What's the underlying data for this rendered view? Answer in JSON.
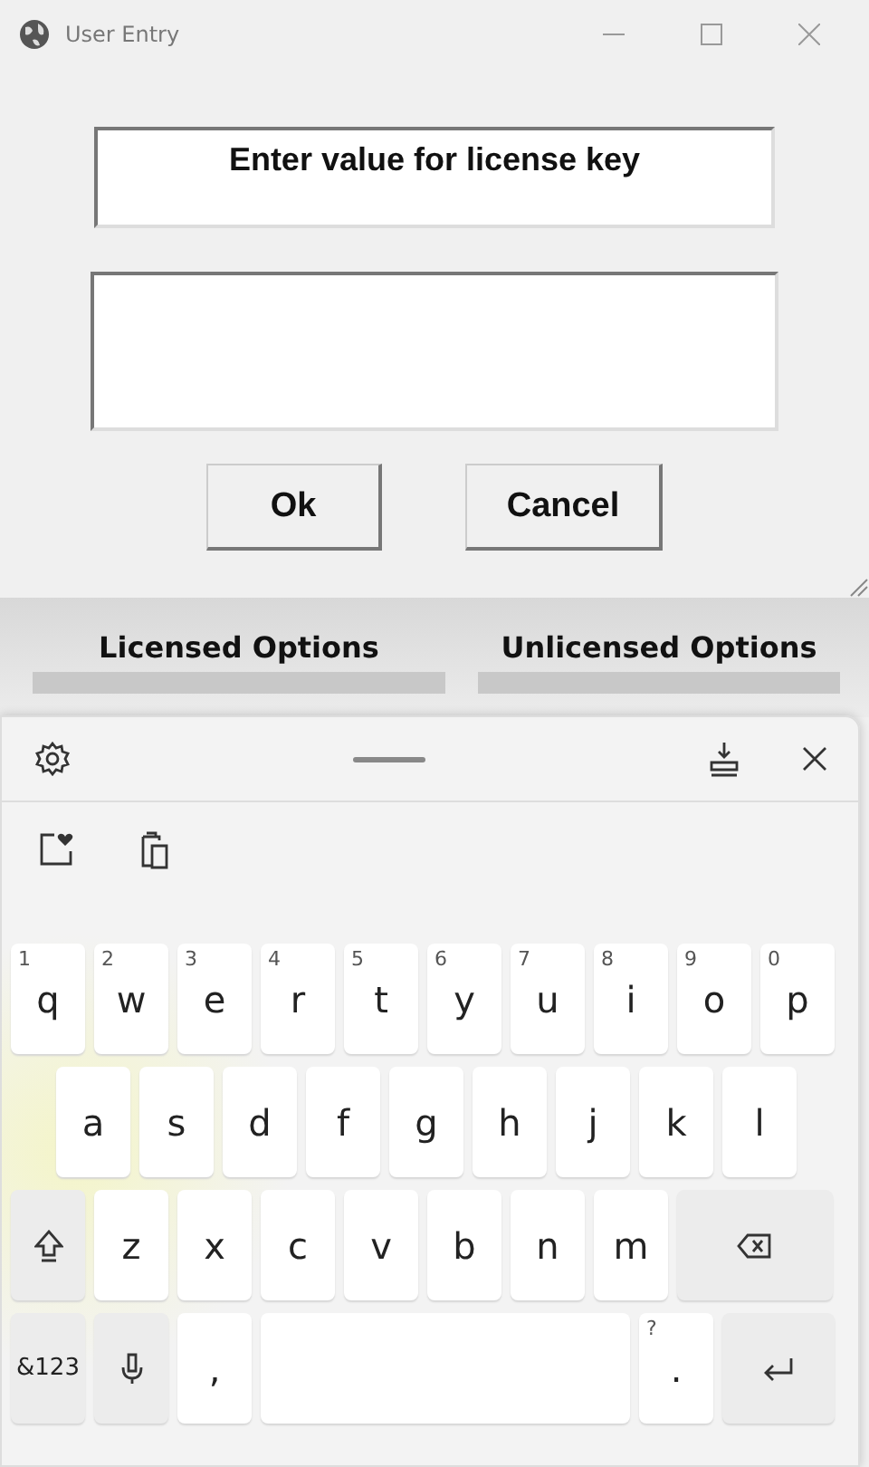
{
  "window": {
    "title": "User Entry"
  },
  "dialog": {
    "prompt": "Enter value for license key",
    "buttons": [
      {
        "label": "Ok"
      },
      {
        "label": "Cancel"
      }
    ]
  },
  "background_app": {
    "columns": [
      {
        "heading": "Licensed Options"
      },
      {
        "heading": "Unlicensed Options"
      }
    ]
  },
  "keyboard": {
    "rows": [
      [
        {
          "kind": "letter",
          "label": "q",
          "hint": "1"
        },
        {
          "kind": "letter",
          "label": "w",
          "hint": "2"
        },
        {
          "kind": "letter",
          "label": "e",
          "hint": "3"
        },
        {
          "kind": "letter",
          "label": "r",
          "hint": "4"
        },
        {
          "kind": "letter",
          "label": "t",
          "hint": "5"
        },
        {
          "kind": "letter",
          "label": "y",
          "hint": "6"
        },
        {
          "kind": "letter",
          "label": "u",
          "hint": "7"
        },
        {
          "kind": "letter",
          "label": "i",
          "hint": "8"
        },
        {
          "kind": "letter",
          "label": "o",
          "hint": "9"
        },
        {
          "kind": "letter",
          "label": "p",
          "hint": "0"
        }
      ],
      [
        {
          "kind": "letter",
          "label": "a"
        },
        {
          "kind": "letter",
          "label": "s"
        },
        {
          "kind": "letter",
          "label": "d"
        },
        {
          "kind": "letter",
          "label": "f"
        },
        {
          "kind": "letter",
          "label": "g"
        },
        {
          "kind": "letter",
          "label": "h"
        },
        {
          "kind": "letter",
          "label": "j"
        },
        {
          "kind": "letter",
          "label": "k"
        },
        {
          "kind": "letter",
          "label": "l"
        }
      ],
      [
        {
          "kind": "shift"
        },
        {
          "kind": "letter",
          "label": "z"
        },
        {
          "kind": "letter",
          "label": "x"
        },
        {
          "kind": "letter",
          "label": "c"
        },
        {
          "kind": "letter",
          "label": "v"
        },
        {
          "kind": "letter",
          "label": "b"
        },
        {
          "kind": "letter",
          "label": "n"
        },
        {
          "kind": "letter",
          "label": "m"
        },
        {
          "kind": "backspace"
        }
      ],
      [
        {
          "kind": "symbols",
          "label": "&123"
        },
        {
          "kind": "mic"
        },
        {
          "kind": "letter",
          "label": ","
        },
        {
          "kind": "space"
        },
        {
          "kind": "letter",
          "label": ".",
          "hint": "?"
        },
        {
          "kind": "enter"
        }
      ]
    ]
  }
}
